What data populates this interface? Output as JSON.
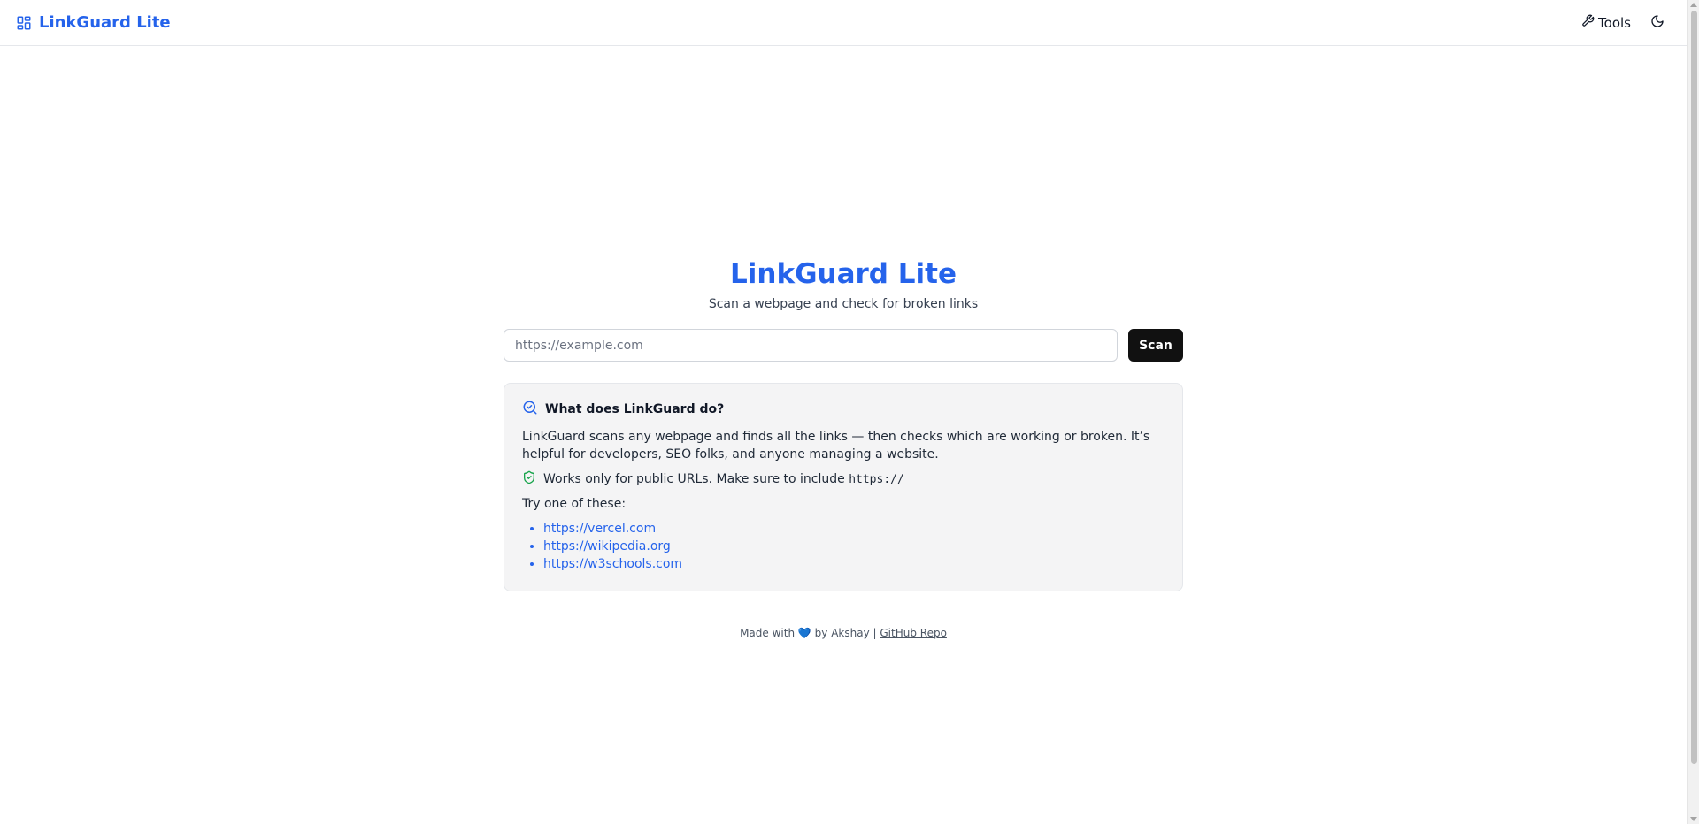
{
  "navbar": {
    "brand": "LinkGuard Lite",
    "tools_label": "Tools",
    "brand_color": "#2563eb"
  },
  "hero": {
    "title": "LinkGuard Lite",
    "subtitle": "Scan a webpage and check for broken links"
  },
  "search": {
    "placeholder": "https://example.com",
    "value": "",
    "button_label": "Scan"
  },
  "info": {
    "heading": "What does LinkGuard do?",
    "description": "LinkGuard scans any webpage and finds all the links — then checks which are working or broken. It’s helpful for developers, SEO folks, and anyone managing a website.",
    "note_text": "Works only for public URLs. Make sure to include",
    "note_code": "https://",
    "try_label": "Try one of these:",
    "examples": [
      "https://vercel.com",
      "https://wikipedia.org",
      "https://w3schools.com"
    ]
  },
  "footer": {
    "made_with": "Made with",
    "heart": "💙",
    "by": "by Akshay |",
    "repo_link": "GitHub Repo"
  },
  "icons": {
    "brand": "layout-grid-icon",
    "tools": "wrench-icon",
    "theme": "moon-icon",
    "info": "search-check-icon",
    "note": "shield-check-icon"
  }
}
